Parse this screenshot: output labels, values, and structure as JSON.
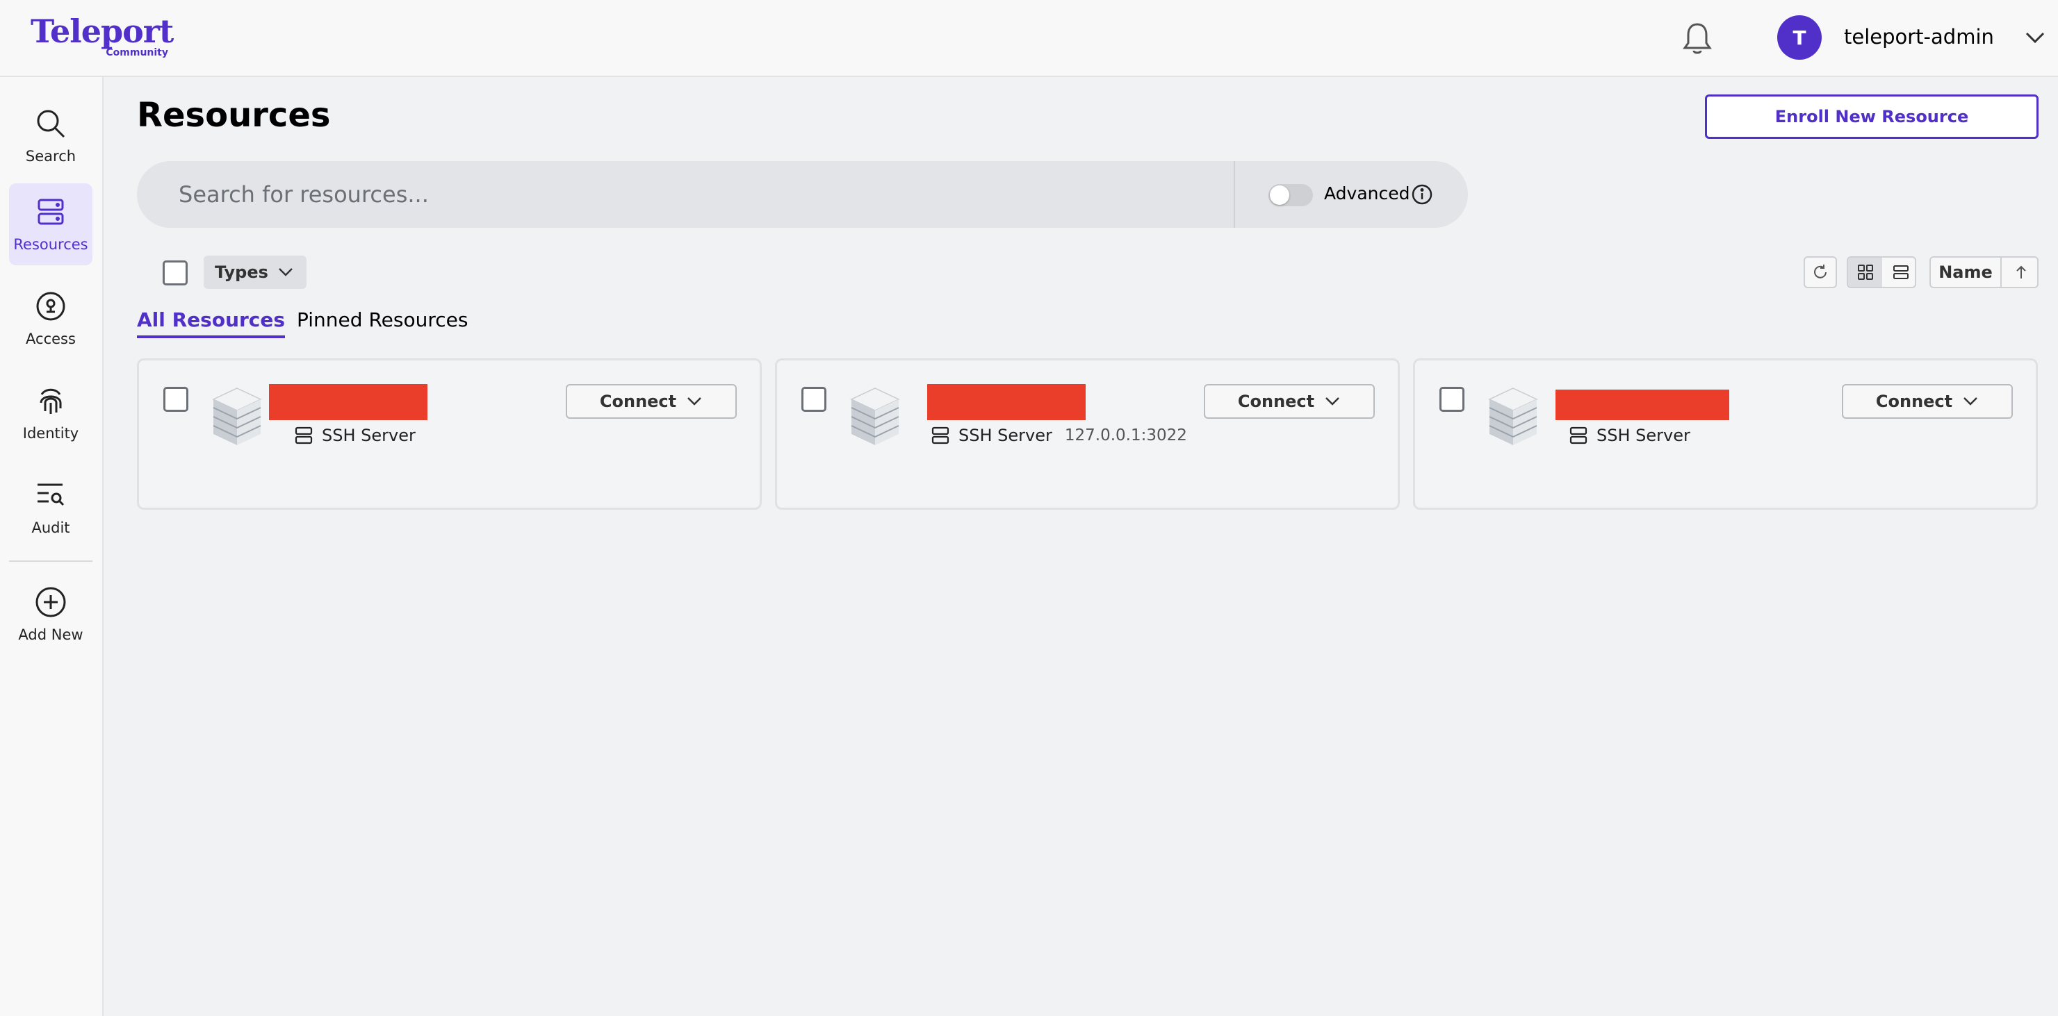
{
  "app": {
    "logo_word": "Teleport",
    "logo_sub": "Community",
    "brand_color": "#512fc9"
  },
  "header": {
    "avatar_initial": "T",
    "username": "teleport-admin"
  },
  "nav": {
    "items": [
      {
        "label": "Search",
        "icon": "search-icon"
      },
      {
        "label": "Resources",
        "icon": "server-stack-icon",
        "active": true
      },
      {
        "label": "Access",
        "icon": "lock-circle-icon"
      },
      {
        "label": "Identity",
        "icon": "fingerprint-icon"
      },
      {
        "label": "Audit",
        "icon": "list-search-icon"
      },
      {
        "label": "Add New",
        "icon": "plus-circle-icon"
      }
    ]
  },
  "main": {
    "title": "Resources",
    "enroll_label": "Enroll New Resource",
    "search_placeholder": "Search for resources...",
    "advanced_label": "Advanced",
    "advanced_enabled": false,
    "types_label": "Types",
    "sort_field": "Name",
    "sort_direction": "ascending",
    "view_mode": "grid",
    "tabs": [
      {
        "label": "All Resources",
        "active": true
      },
      {
        "label": "Pinned Resources",
        "active": false
      }
    ]
  },
  "resources": [
    {
      "type": "SSH Server",
      "address": "",
      "connect_label": "Connect",
      "name_redacted": true
    },
    {
      "type": "SSH Server",
      "address": "127.0.0.1:3022",
      "connect_label": "Connect",
      "name_redacted": true
    },
    {
      "type": "SSH Server",
      "address": "",
      "connect_label": "Connect",
      "name_redacted": true
    }
  ],
  "colors": {
    "redaction": "#ea3e2a",
    "accent": "#512fc9",
    "active_nav_bg": "#e8e4fb"
  }
}
